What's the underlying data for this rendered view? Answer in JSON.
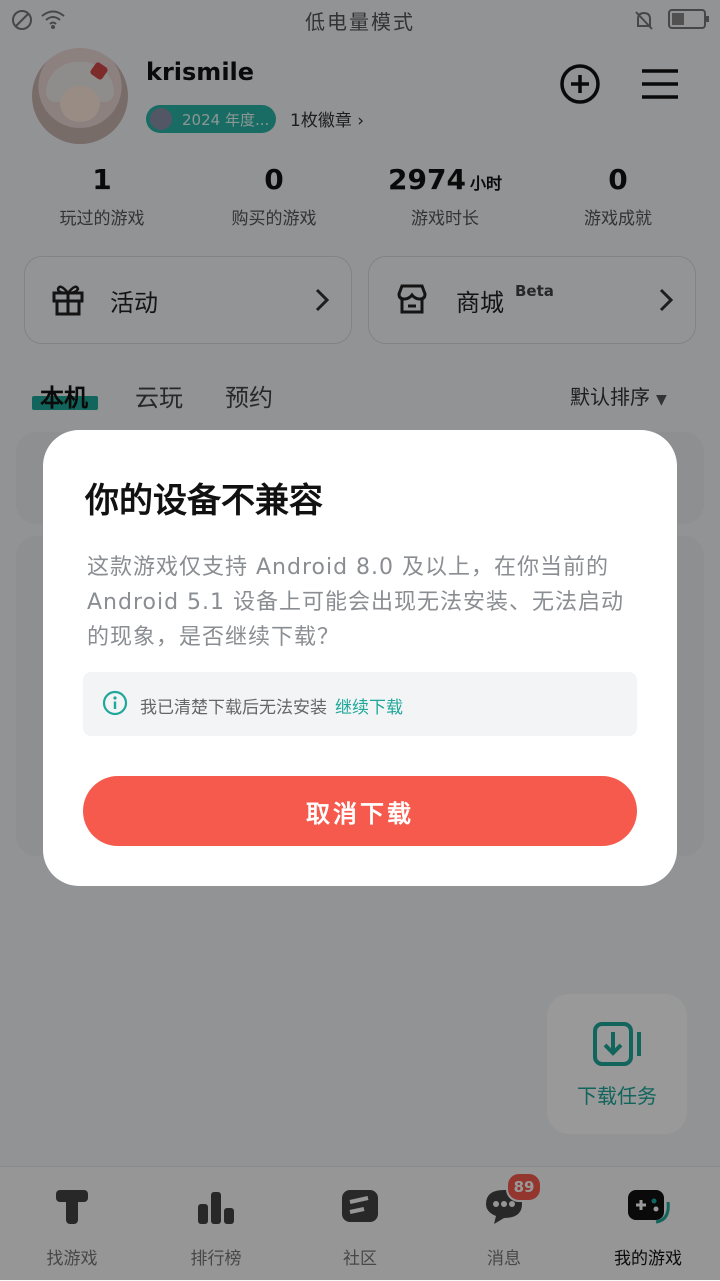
{
  "status_bar": {
    "title": "低电量模式"
  },
  "profile": {
    "username": "krismile",
    "badge_text": "2024 年度...",
    "badge_count": "1枚徽章 ›"
  },
  "stats": [
    {
      "value": "1",
      "unit": "",
      "label": "玩过的游戏"
    },
    {
      "value": "0",
      "unit": "",
      "label": "购买的游戏"
    },
    {
      "value": "2974",
      "unit": "小时",
      "label": "游戏时长"
    },
    {
      "value": "0",
      "unit": "",
      "label": "游戏成就"
    }
  ],
  "cards": {
    "activity": "活动",
    "store": "商城",
    "store_tag": "Beta"
  },
  "tabs": [
    "本机",
    "云玩",
    "预约"
  ],
  "sort_label": "默认排序",
  "dialog": {
    "title": "你的设备不兼容",
    "body": "这款游戏仅支持 Android 8.0 及以上，在你当前的 Android 5.1 设备上可能会出现无法安装、无法启动的现象，是否继续下载？",
    "notice": "我已清楚下载后无法安装",
    "notice_link": "继续下载",
    "cancel_button": "取消下载"
  },
  "float_task": {
    "label": "下载任务"
  },
  "bottom_nav": [
    {
      "label": "找游戏",
      "icon": "find-game-icon"
    },
    {
      "label": "排行榜",
      "icon": "ranking-icon"
    },
    {
      "label": "社区",
      "icon": "community-icon"
    },
    {
      "label": "消息",
      "icon": "message-icon",
      "badge": "89"
    },
    {
      "label": "我的游戏",
      "icon": "my-games-icon"
    }
  ],
  "colors": {
    "accent": "#1fa899",
    "danger": "#f65a4d"
  }
}
